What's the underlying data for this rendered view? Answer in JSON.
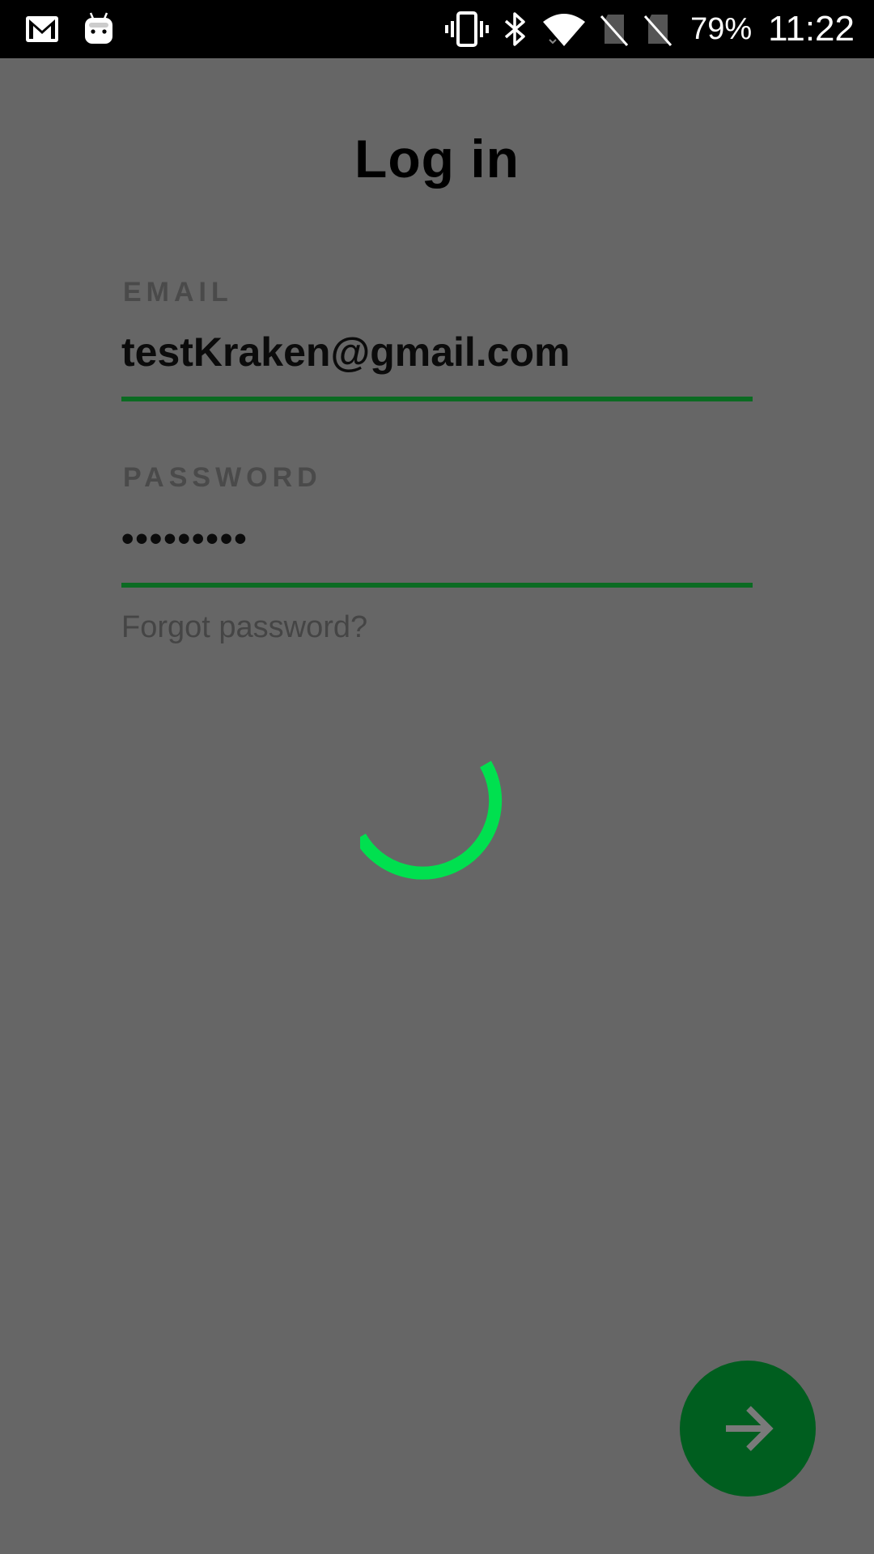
{
  "status_bar": {
    "left_icons": [
      "gmail-icon",
      "android-icon"
    ],
    "right_icons": [
      "vibrate-icon",
      "bluetooth-icon",
      "wifi-icon",
      "no-sim-icon",
      "no-sim-icon"
    ],
    "battery_percent": "79%",
    "time": "11:22"
  },
  "login": {
    "title": "Log in",
    "email_label": "EMAIL",
    "email_value": "testKraken@gmail.com",
    "password_label": "PASSWORD",
    "password_value": "•••••••••",
    "forgot_label": "Forgot password?",
    "loading": true,
    "next_icon": "arrow-right-icon"
  },
  "colors": {
    "background": "#666666",
    "accent_underline": "#0b6b22",
    "spinner": "#00e04f",
    "button": "#005e1f",
    "button_icon": "#7a7a7a"
  }
}
